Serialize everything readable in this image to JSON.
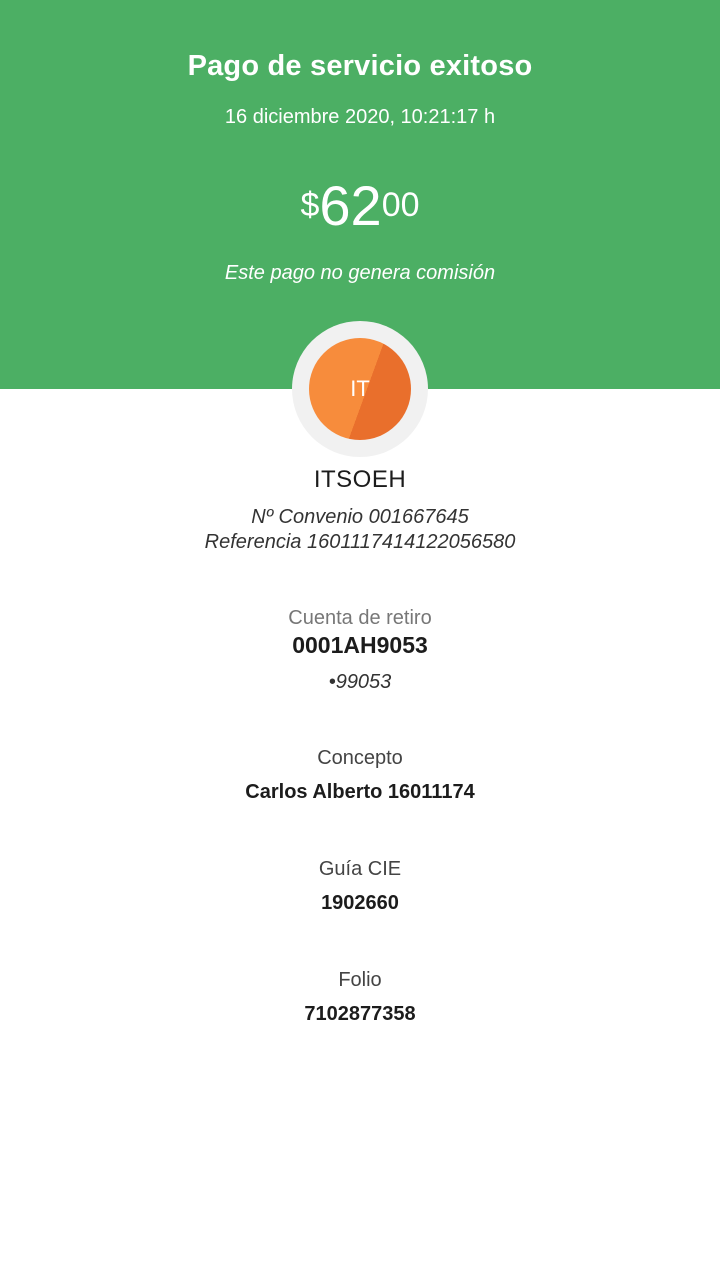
{
  "header": {
    "title": "Pago de servicio exitoso",
    "date": "16 diciembre 2020, 10:21:17 h",
    "amount": {
      "currency": "$",
      "integer": "62",
      "decimals": "00"
    },
    "commission_note": "Este pago no genera comisión",
    "background_color": "#4caf64"
  },
  "biller": {
    "initials": "IT",
    "name": "ITSOEH",
    "convenio": "Nº Convenio 001667645",
    "referencia": "Referencia 1601117414122056580",
    "avatar_color": "#f78c3c"
  },
  "details": {
    "account_label": "Cuenta de retiro",
    "account_value": "0001AH9053",
    "account_masked": "•99053",
    "concept_label": "Concepto",
    "concept_value": "Carlos Alberto 16011174",
    "guide_label": "Guía CIE",
    "guide_value": "1902660",
    "folio_label": "Folio",
    "folio_value": "7102877358"
  }
}
